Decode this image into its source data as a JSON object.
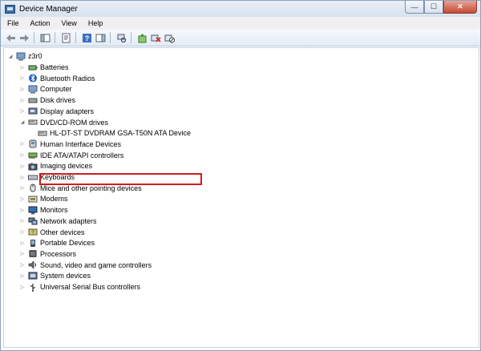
{
  "window": {
    "title": "Device Manager",
    "controls": {
      "minimize": "—",
      "maximize": "☐",
      "close": "✕"
    }
  },
  "menubar": {
    "items": [
      "File",
      "Action",
      "View",
      "Help"
    ]
  },
  "toolbar": {
    "icons": [
      "back-icon",
      "forward-icon",
      "show-hide-console-tree-icon",
      "properties-icon",
      "help-icon",
      "action-pane-icon",
      "scan-hardware-icon",
      "update-driver-icon",
      "uninstall-icon",
      "disable-icon"
    ]
  },
  "tree": {
    "root": "z3r0",
    "categories": [
      {
        "label": "Batteries",
        "icon": "battery-icon"
      },
      {
        "label": "Bluetooth Radios",
        "icon": "bluetooth-icon"
      },
      {
        "label": "Computer",
        "icon": "computer-icon"
      },
      {
        "label": "Disk drives",
        "icon": "disk-drive-icon"
      },
      {
        "label": "Display adapters",
        "icon": "display-adapter-icon"
      },
      {
        "label": "DVD/CD-ROM drives",
        "icon": "dvd-drive-icon",
        "expanded": true
      },
      {
        "label": "HL-DT-ST DVDRAM GSA-T50N ATA Device",
        "icon": "dvd-drive-icon",
        "child": true,
        "selected": true
      },
      {
        "label": "Human Interface Devices",
        "icon": "hid-icon"
      },
      {
        "label": "IDE ATA/ATAPI controllers",
        "icon": "ide-controller-icon"
      },
      {
        "label": "Imaging devices",
        "icon": "camera-icon"
      },
      {
        "label": "Keyboards",
        "icon": "keyboard-icon"
      },
      {
        "label": "Mice and other pointing devices",
        "icon": "mouse-icon"
      },
      {
        "label": "Modems",
        "icon": "modem-icon"
      },
      {
        "label": "Monitors",
        "icon": "monitor-icon"
      },
      {
        "label": "Network adapters",
        "icon": "network-adapter-icon"
      },
      {
        "label": "Other devices",
        "icon": "other-devices-icon"
      },
      {
        "label": "Portable Devices",
        "icon": "portable-device-icon"
      },
      {
        "label": "Processors",
        "icon": "processor-icon"
      },
      {
        "label": "Sound, video and game controllers",
        "icon": "sound-icon"
      },
      {
        "label": "System devices",
        "icon": "system-devices-icon"
      },
      {
        "label": "Universal Serial Bus controllers",
        "icon": "usb-icon"
      }
    ]
  }
}
